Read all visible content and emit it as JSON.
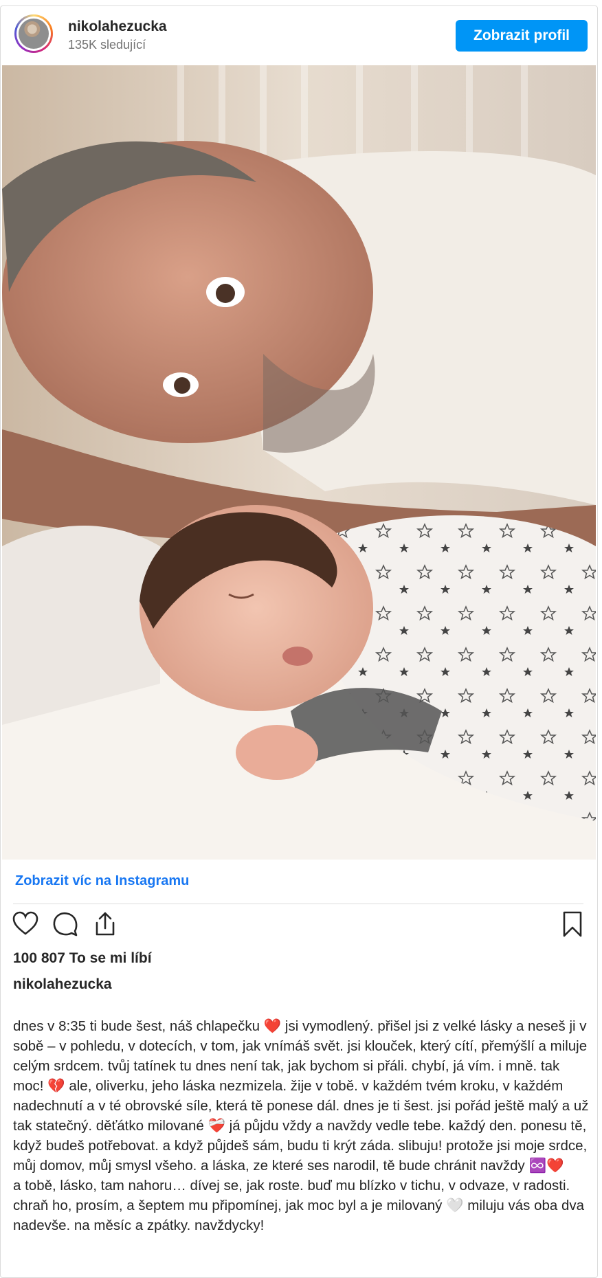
{
  "header": {
    "username": "nikolahezucka",
    "followers": "135K sledující",
    "profile_button": "Zobrazit profil"
  },
  "post": {
    "image_description_icon": "photo-father-and-newborn",
    "view_more_link": "Zobrazit víc na Instagramu",
    "likes": "100 807 To se mi líbí",
    "author": "nikolahezucka",
    "caption": [
      "dnes v 8:35 ti bude šest, náš chlapečku ❤️ jsi vymodlený. přišel jsi z velké lásky a neseš ji v sobě – v pohledu, v dotecích, v tom, jak vnímáš svět. jsi klouček, který cítí, přemýšlí a miluje celým srdcem. tvůj tatínek tu dnes není tak, jak bychom si přáli. chybí, já vím. i mně. tak moc! 💔 ale, oliverku, jeho láska nezmizela. žije v tobě. v každém tvém kroku, v každém nadechnutí a v té obrovské síle, která tě ponese dál. dnes je ti šest. jsi pořád ještě malý a už tak statečný. děťátko milované ❤️‍🩹 já půjdu vždy a navždy vedle tebe. každý den. ponesu tě, když budeš potřebovat. a když půjdeš sám, budu ti krýt záda. slibuju! protože jsi moje srdce, můj domov, můj smysl všeho. a láska, ze které ses narodil, tě bude chránit navždy ♾️❤️",
      "a tobě, lásko, tam nahoru… dívej se, jak roste. buď mu blízko v tichu, v odvaze, v radosti. chraň ho, prosím, a šeptem mu připomínej, jak moc byl a je milovaný 🤍 miluju vás oba dva nadevše. na měsíc a zpátky. navždycky!"
    ]
  },
  "icons": {
    "like": "heart-icon",
    "comment": "comment-icon",
    "share": "share-icon",
    "save": "bookmark-icon"
  },
  "colors": {
    "accent": "#0095f6",
    "link": "#1877f2",
    "text": "#262626",
    "muted": "#737373"
  }
}
